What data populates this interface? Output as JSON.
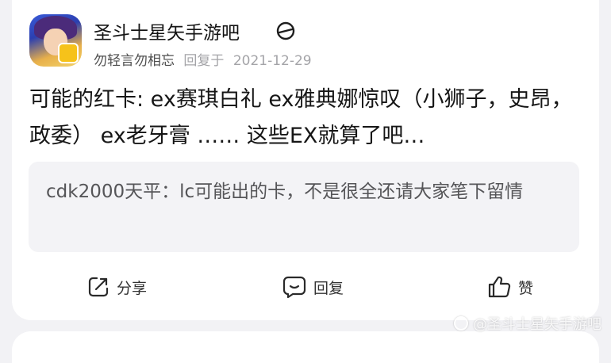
{
  "post": {
    "forum_name": "圣斗士星矢手游吧",
    "author": "勿轻言勿相忘",
    "action": "回复于",
    "date": "2021-12-29",
    "content": "可能的红卡: ex赛琪白礼 ex雅典娜惊叹（小狮子，史昂，政委） ex老牙膏 …… 这些EX就算了吧…",
    "quote": "cdk2000天平：lc可能出的卡，不是很全还请大家笔下留情"
  },
  "actions": {
    "share_label": "分享",
    "reply_label": "回复",
    "like_label": "赞"
  },
  "watermark": {
    "text": "@圣斗士星矢手游吧"
  },
  "colors": {
    "background": "#f2f2f5",
    "card": "#ffffff",
    "quote_bg": "#f3f3f6",
    "meta_gray": "#a4a4a8"
  }
}
